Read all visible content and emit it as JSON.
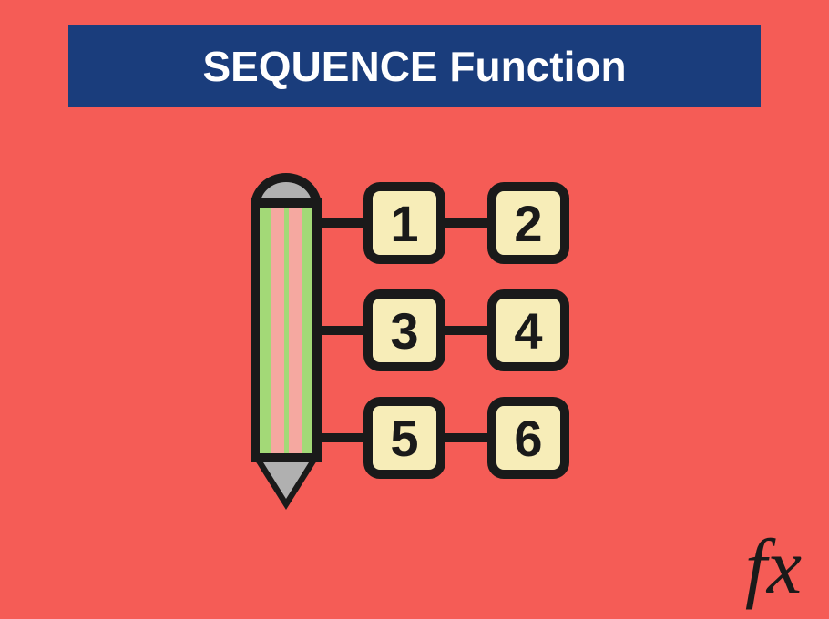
{
  "title": "SEQUENCE Function",
  "fx_label": "fx",
  "colors": {
    "background": "#F55C56",
    "banner": "#1A3D7C",
    "banner_text": "#FFFFFF",
    "box_fill": "#F7EDB8",
    "outline": "#1a1a1a",
    "pencil_body": "#A3D977",
    "pencil_stripe": "#F5A8A0",
    "pencil_eraser": "#B0B0B0"
  },
  "sequence_grid": {
    "rows": 3,
    "cols": 2,
    "values": [
      [
        "1",
        "2"
      ],
      [
        "3",
        "4"
      ],
      [
        "5",
        "6"
      ]
    ]
  },
  "icons": {
    "pencil": "pencil-icon",
    "fx": "fx-symbol"
  }
}
